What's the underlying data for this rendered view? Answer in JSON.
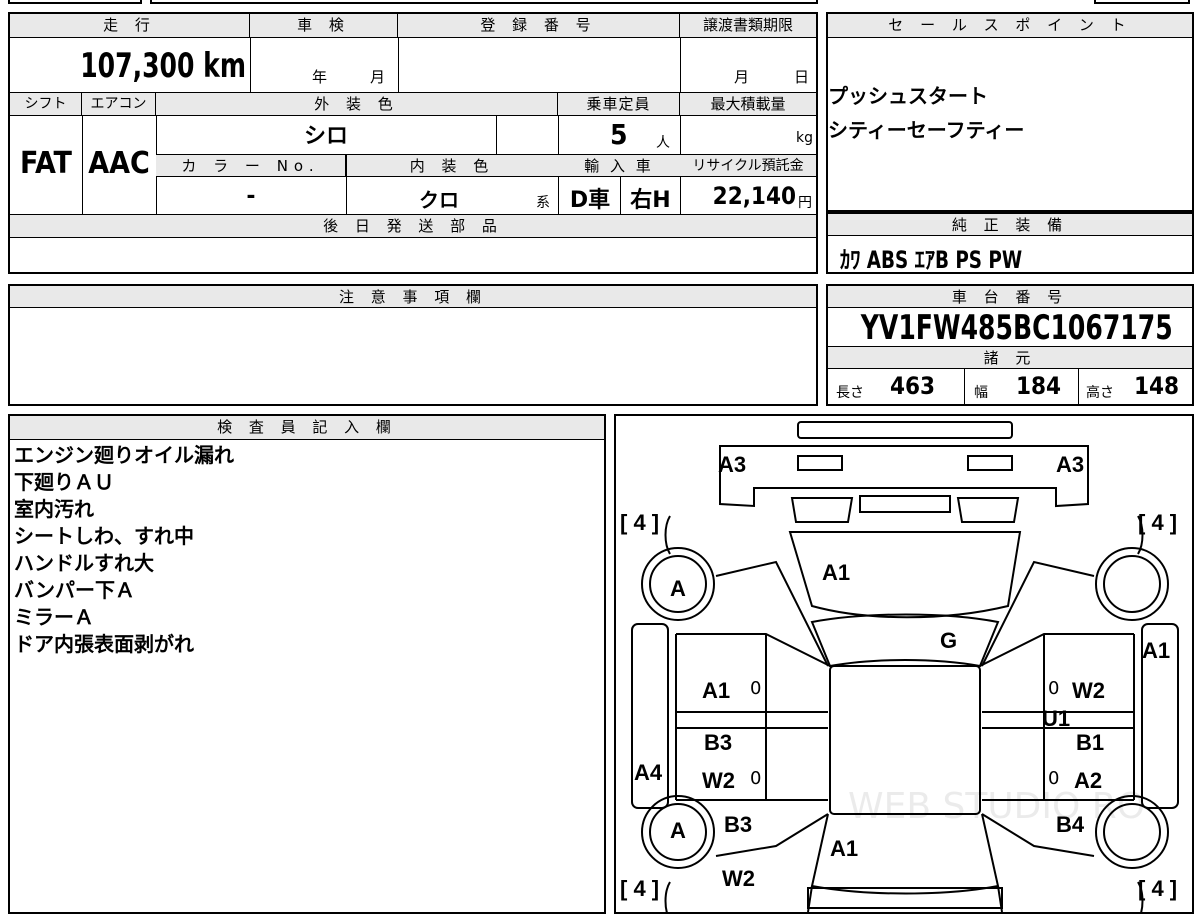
{
  "mileage": {
    "header": "走 行",
    "value": "107,300 km"
  },
  "shaken": {
    "header": "車 検",
    "year": "年",
    "month": "月"
  },
  "registration": {
    "header": "登 録 番 号"
  },
  "transfer": {
    "header": "譲渡書類期限",
    "month": "月",
    "day": "日"
  },
  "sales_point": {
    "header": "セ ー ル ス ポ イ ン ト",
    "lines": [
      "プッシュスタート",
      "シティーセーフティー"
    ]
  },
  "shift": {
    "header": "シフト",
    "value": "FAT"
  },
  "aircon": {
    "header": "エアコン",
    "value": "AAC"
  },
  "exterior_color": {
    "header": "外 装 色",
    "value": "シロ"
  },
  "capacity": {
    "header": "乗車定員",
    "value": "5",
    "unit": "人"
  },
  "max_load": {
    "header": "最大積載量",
    "unit": "kg"
  },
  "color_no": {
    "header": "カ ラ ー No.",
    "value": "-"
  },
  "interior_color": {
    "header": "内 装 色",
    "value": "クロ",
    "suffix": "系"
  },
  "import": {
    "header": "輸 入 車",
    "type": "D車",
    "handle": "右H"
  },
  "recycle": {
    "header": "リサイクル預託金",
    "value": "22,140",
    "unit": "円"
  },
  "later_parts": {
    "header": "後 日 発 送 部 品"
  },
  "equipment": {
    "header": "純 正 装 備",
    "value": "ｶﾜ ABS ｴｱB PS PW"
  },
  "notes": {
    "header": "注 意 事 項 欄"
  },
  "chassis": {
    "header": "車 台 番 号",
    "value": "YV1FW485BC1067175"
  },
  "specs": {
    "header": "諸 元",
    "length_label": "長さ",
    "length": "463",
    "width_label": "幅",
    "width": "184",
    "height_label": "高さ",
    "height": "148"
  },
  "inspector": {
    "header": "検 査 員 記 入 欄",
    "lines": [
      "エンジン廻りオイル漏れ",
      "下廻りＡＵ",
      "室内汚れ",
      "シートしわ、すれ中",
      "ハンドルすれ大",
      "バンパー下Ａ",
      "ミラーＡ",
      "ドア内張表面剥がれ"
    ]
  },
  "diagram": {
    "marks": {
      "a3_left": "A3",
      "a3_right": "A3",
      "tire_fl": "[ 4 ]",
      "tire_fr": "[ 4 ]",
      "hood": "A1",
      "windshield": "G",
      "wheel_fl": "A",
      "fender_r": "A1",
      "door_fl": "A1",
      "zero1": "0",
      "zero2": "0",
      "door_fr": "W2",
      "u1": "U1",
      "door_rl_b": "B3",
      "door_rr_b": "B1",
      "door_rl_w": "W2",
      "zero3": "0",
      "zero4": "0",
      "door_rr_a": "A2",
      "side_l": "A4",
      "wheel_rl": "A",
      "qtr_l": "B3",
      "qtr_r": "B4",
      "roof": "A1",
      "rear_w2": "W2",
      "tire_rl": "[ 4 ]",
      "tire_rr": "[ 4 ]"
    },
    "watermark": "WEB STUDIO RO"
  }
}
